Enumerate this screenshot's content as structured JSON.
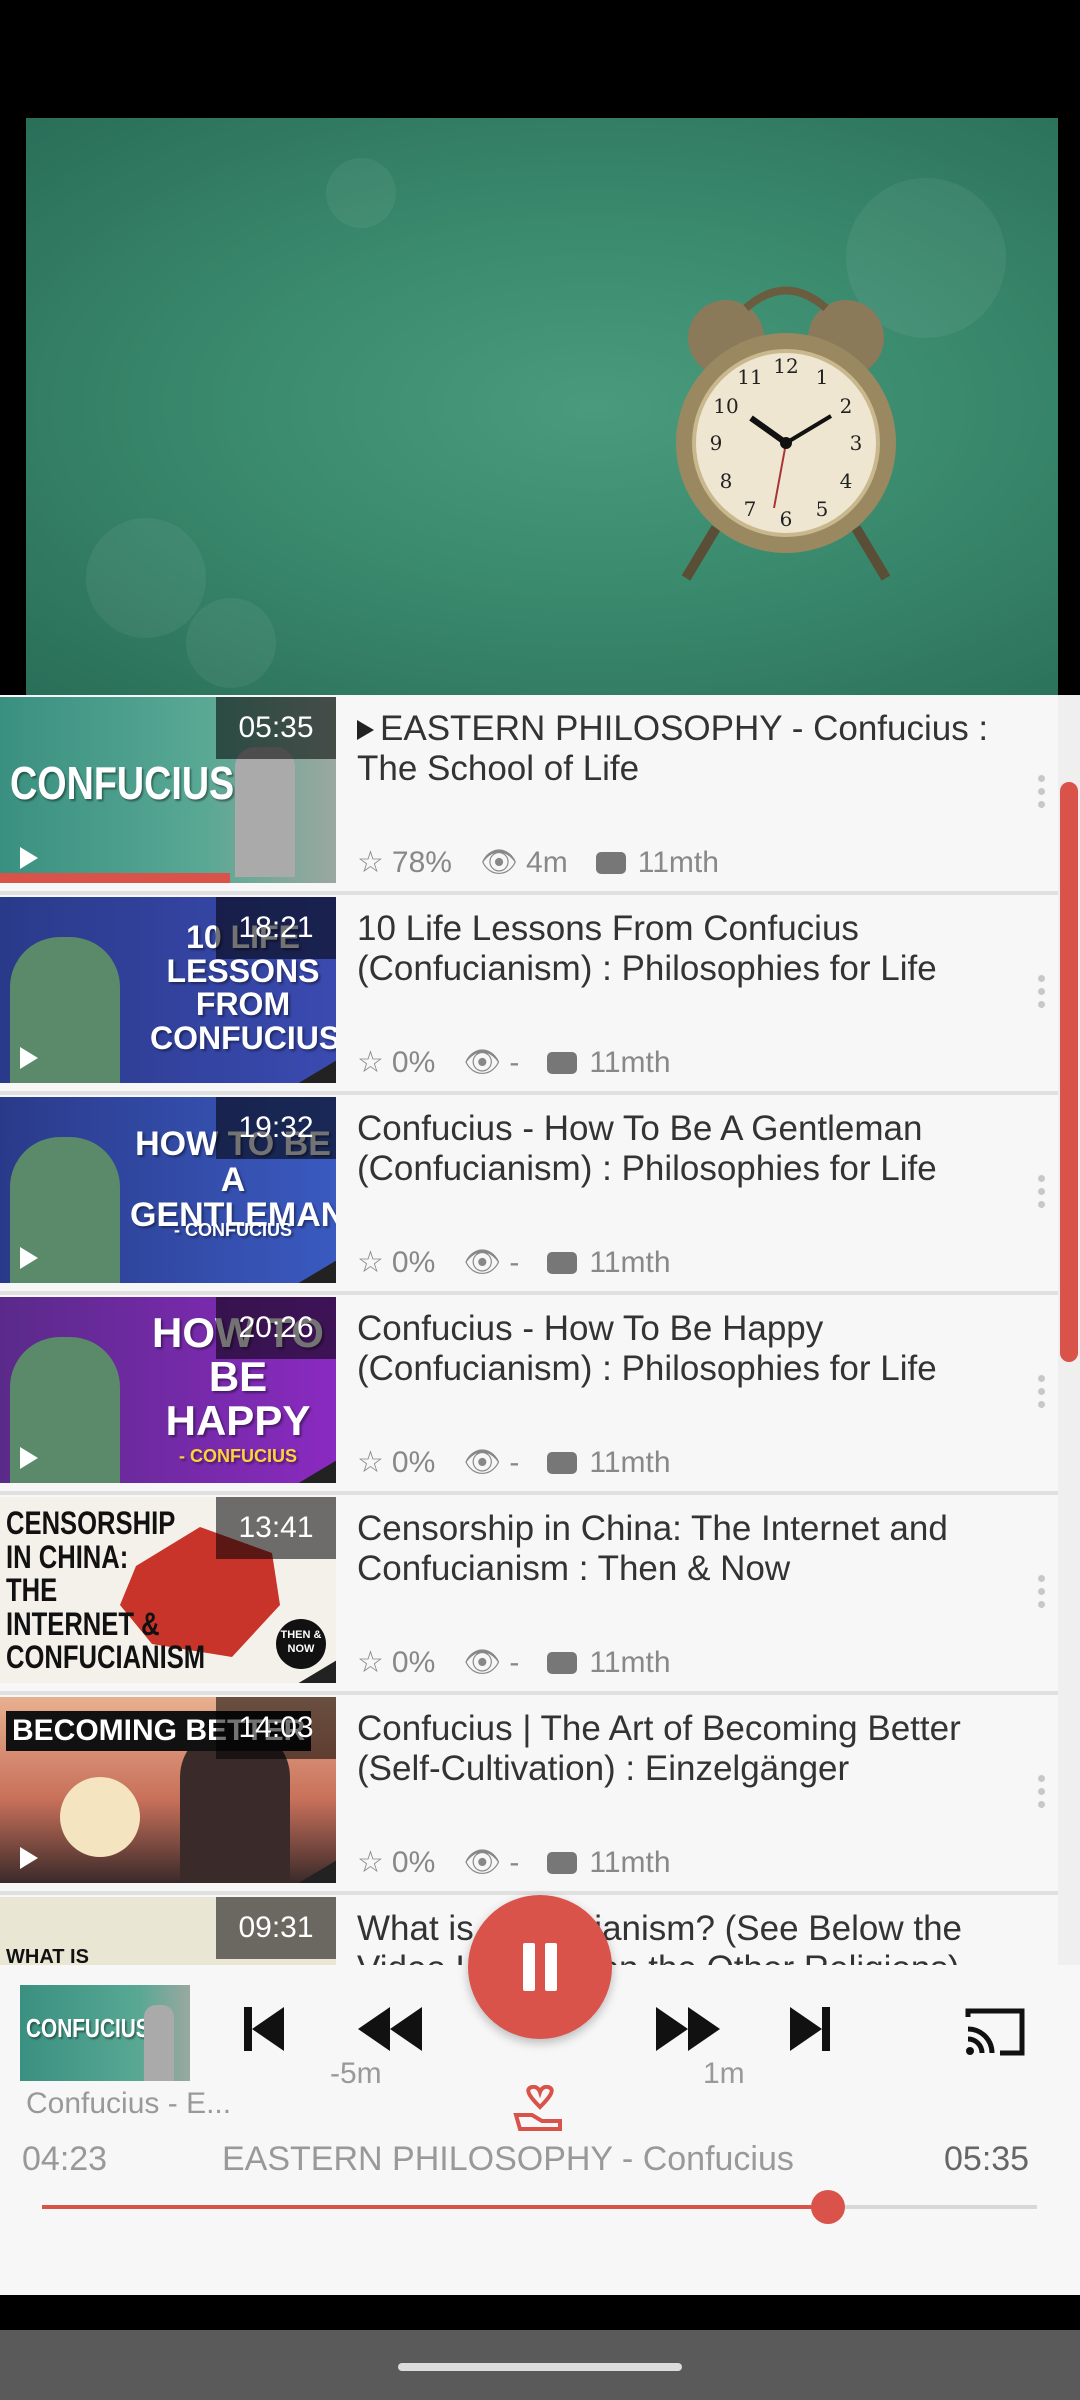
{
  "playlist": [
    {
      "duration": "05:35",
      "title": "EASTERN PHILOSOPHY - Confucius : The School of Life",
      "rating": "78%",
      "views": "4m",
      "age": "11mth",
      "thumb_text": "CONFUCIUS",
      "playing": true
    },
    {
      "duration": "18:21",
      "title": "10 Life Lessons From Confucius (Confucianism) : Philosophies for Life",
      "rating": "0%",
      "views": "-",
      "age": "11mth",
      "thumb_text": "10 LIFE LESSONS FROM CONFUCIUS"
    },
    {
      "duration": "19:32",
      "title": "Confucius - How To Be A Gentleman (Confucianism) : Philosophies for Life",
      "rating": "0%",
      "views": "-",
      "age": "11mth",
      "thumb_text": "HOW TO BE A GENTLEMAN",
      "thumb_sub": "- CONFUCIUS"
    },
    {
      "duration": "20:26",
      "title": "Confucius - How To Be Happy (Confucianism) : Philosophies for Life",
      "rating": "0%",
      "views": "-",
      "age": "11mth",
      "thumb_text": "HOW TO BE HAPPY",
      "thumb_sub": "- CONFUCIUS"
    },
    {
      "duration": "13:41",
      "title": "Censorship in China: The Internet and Confucianism : Then & Now",
      "rating": "0%",
      "views": "-",
      "age": "11mth",
      "thumb_text": "CENSORSHIP IN CHINA: THE INTERNET & CONFUCIANISM",
      "thumb_badge": "THEN & NOW"
    },
    {
      "duration": "14:03",
      "title": "Confucius | The Art of Becoming Better (Self-Cultivation) : Einzelgänger",
      "rating": "0%",
      "views": "-",
      "age": "11mth",
      "thumb_text": "BECOMING BETTER"
    },
    {
      "duration": "09:31",
      "title": "What is Confucianism? (See Below the Video Lectures on the Other Religions)",
      "rating": "",
      "views": "",
      "age": "",
      "thumb_text": "WHAT IS"
    }
  ],
  "player": {
    "current_title_short": "Confucius - E...",
    "current_time": "04:23",
    "track_title": "EASTERN PHILOSOPHY - Confucius",
    "total_time": "05:35",
    "rewind_label": "-5m",
    "forward_label": "1m",
    "thumb_text": "CONFUCIUS",
    "progress": 0.79
  },
  "colors": {
    "accent": "#d9534a",
    "video_bg": "#3a8a6e"
  }
}
